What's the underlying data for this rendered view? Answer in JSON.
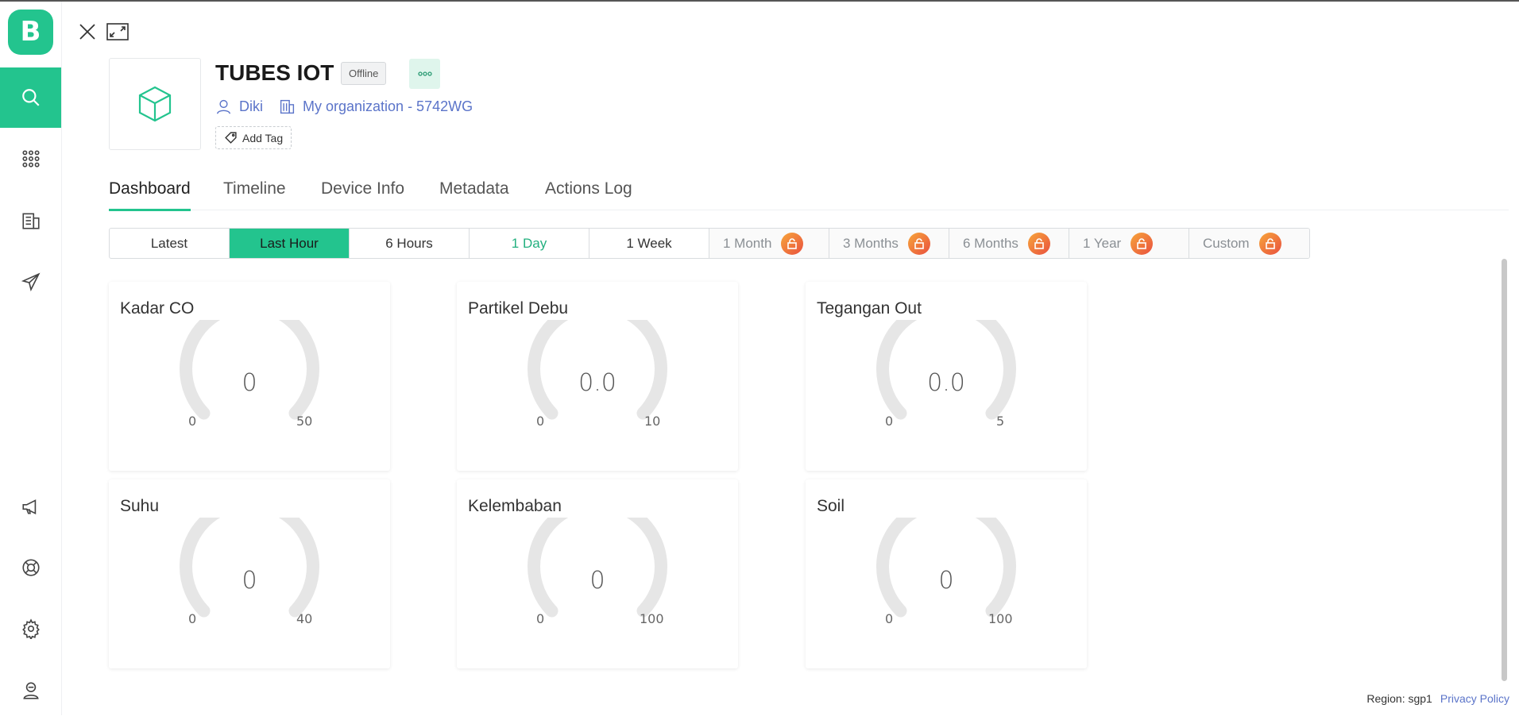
{
  "app": {
    "logo_letter": "B"
  },
  "sidebar": {
    "items": [
      {
        "name": "search-icon",
        "active": true
      },
      {
        "name": "apps-grid-icon"
      },
      {
        "name": "organization-icon"
      },
      {
        "name": "send-icon"
      },
      {
        "name": "megaphone-icon"
      },
      {
        "name": "help-icon"
      },
      {
        "name": "settings-icon"
      },
      {
        "name": "user-profile-icon"
      }
    ]
  },
  "device": {
    "title": "TUBES IOT",
    "status": "Offline",
    "owner": "Diki",
    "organization": "My organization - 5742WG",
    "add_tag_label": "Add Tag"
  },
  "tabs": [
    "Dashboard",
    "Timeline",
    "Device Info",
    "Metadata",
    "Actions Log"
  ],
  "ranges": [
    {
      "label": "Latest"
    },
    {
      "label": "Last Hour",
      "selected": true
    },
    {
      "label": "6 Hours"
    },
    {
      "label": "1 Day"
    },
    {
      "label": "1 Week"
    },
    {
      "label": "1 Month",
      "locked": true
    },
    {
      "label": "3 Months",
      "locked": true
    },
    {
      "label": "6 Months",
      "locked": true
    },
    {
      "label": "1 Year",
      "locked": true
    },
    {
      "label": "Custom",
      "locked": true
    }
  ],
  "widgets": [
    {
      "title": "Kadar CO",
      "value": "0",
      "min": "0",
      "max": "50"
    },
    {
      "title": "Partikel Debu",
      "value": "0.0",
      "min": "0",
      "max": "10"
    },
    {
      "title": "Tegangan Out",
      "value": "0.0",
      "min": "0",
      "max": "5"
    },
    {
      "title": "Suhu",
      "value": "0",
      "min": "0",
      "max": "40"
    },
    {
      "title": "Kelembaban",
      "value": "0",
      "min": "0",
      "max": "100"
    },
    {
      "title": "Soil",
      "value": "0",
      "min": "0",
      "max": "100"
    }
  ],
  "footer": {
    "region": "Region: sgp1",
    "privacy": "Privacy Policy"
  },
  "colors": {
    "accent": "#23c48e",
    "link": "#5b74c9",
    "lock_start": "#f7a63a",
    "lock_end": "#e9503f"
  }
}
